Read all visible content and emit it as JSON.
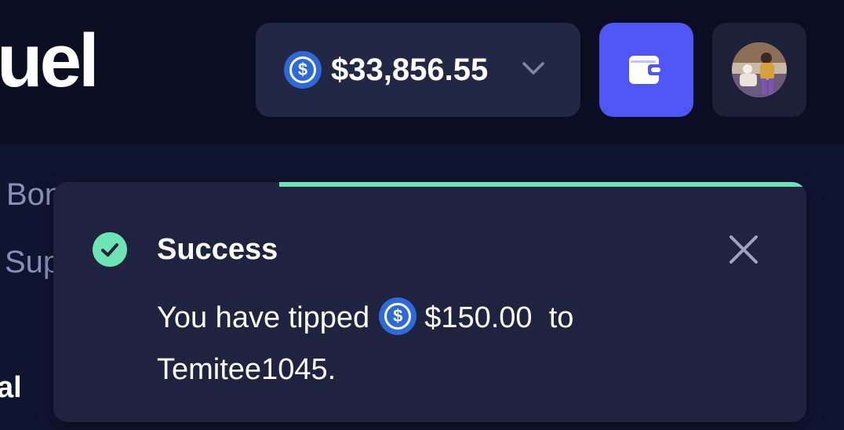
{
  "header": {
    "brand_text": "uel",
    "balance": "$33,856.55",
    "currency_icon": "usdc-coin-icon",
    "wallet_icon": "wallet-icon",
    "avatar_label": "user-avatar"
  },
  "background": {
    "row1_left": "Bon",
    "row2_left": "Sup",
    "row3_left": "al"
  },
  "toast": {
    "title": "Success",
    "message_prefix": "You have tipped",
    "amount": "$150.00",
    "message_middle": "to",
    "recipient": "Temitee1045.",
    "progress": 0.72,
    "colors": {
      "success": "#6ee3b4",
      "accent": "#4f56f3",
      "coin": "#2d6ad7"
    }
  }
}
